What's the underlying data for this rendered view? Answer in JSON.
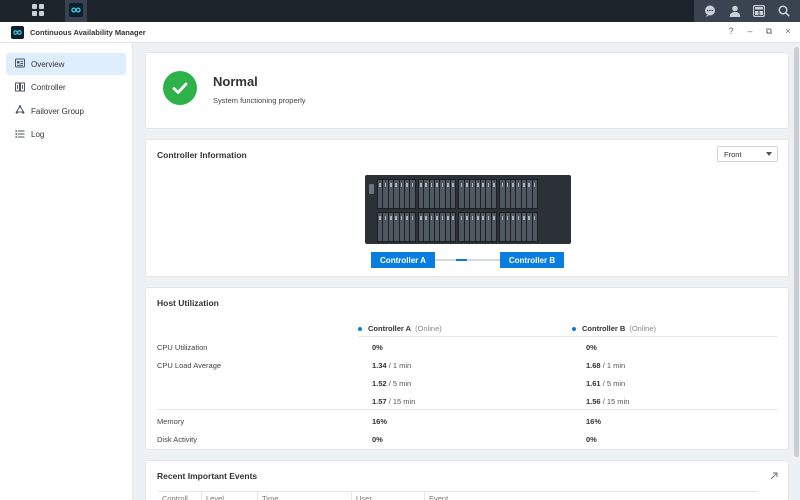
{
  "window": {
    "title": "Continuous Availability Manager"
  },
  "window_controls": [
    "?",
    "–",
    "⧉",
    "×"
  ],
  "sidebar": {
    "items": [
      {
        "label": "Overview",
        "icon": "overview-icon",
        "active": true
      },
      {
        "label": "Controller",
        "icon": "controller-icon",
        "active": false
      },
      {
        "label": "Failover Group",
        "icon": "failover-icon",
        "active": false
      },
      {
        "label": "Log",
        "icon": "log-icon",
        "active": false
      }
    ]
  },
  "status": {
    "title": "Normal",
    "subtitle": "System functioning properly",
    "color": "#2db24a"
  },
  "controller_info": {
    "title": "Controller Information",
    "view_select": "Front",
    "controller_a": "Controller A",
    "controller_b": "Controller B",
    "accent": "#0a7ee0"
  },
  "host_utilization": {
    "title": "Host Utilization",
    "columns": [
      {
        "name": "Controller A",
        "state": "(Online)"
      },
      {
        "name": "Controller B",
        "state": "(Online)"
      }
    ],
    "rows": {
      "cpu_utilization": {
        "label": "CPU Utilization",
        "a": "0%",
        "b": "0%"
      },
      "cpu_load": {
        "label": "CPU Load Average",
        "a": [
          {
            "value": "1.34",
            "unit": "/ 1 min"
          },
          {
            "value": "1.52",
            "unit": "/ 5 min"
          },
          {
            "value": "1.57",
            "unit": "/ 15 min"
          }
        ],
        "b": [
          {
            "value": "1.68",
            "unit": "/ 1 min"
          },
          {
            "value": "1.61",
            "unit": "/ 5 min"
          },
          {
            "value": "1.56",
            "unit": "/ 15 min"
          }
        ]
      },
      "memory": {
        "label": "Memory",
        "a": "16%",
        "b": "16%"
      },
      "disk": {
        "label": "Disk Activity",
        "a": "0%",
        "b": "0%"
      }
    }
  },
  "events": {
    "title": "Recent Important Events",
    "columns": [
      "Controll...",
      "Level",
      "Time",
      "User",
      "Event"
    ]
  }
}
